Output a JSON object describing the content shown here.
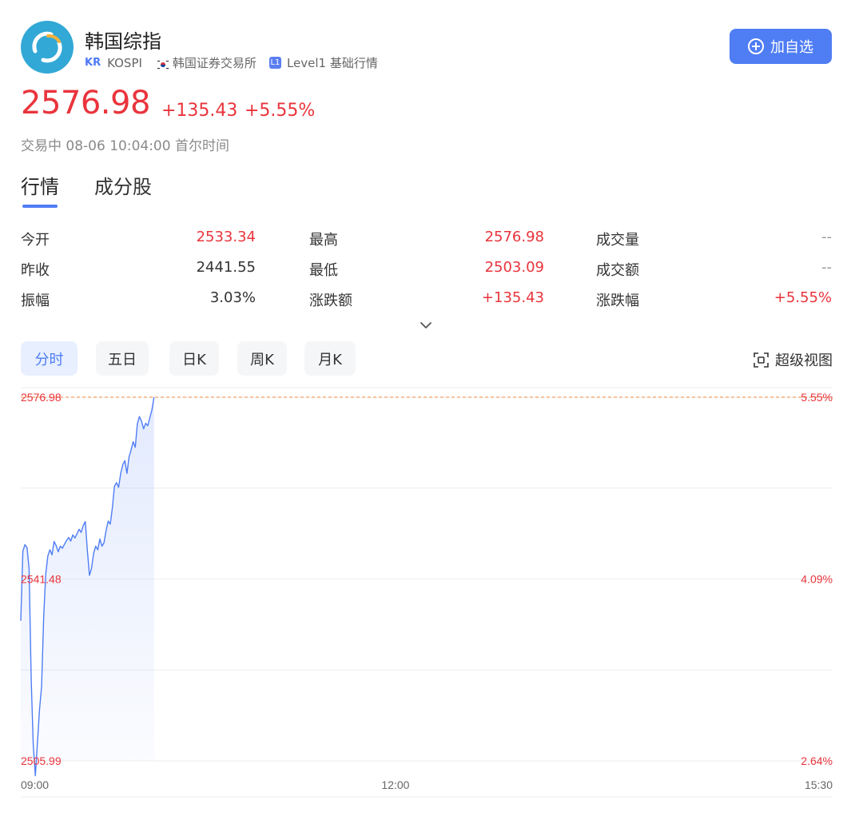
{
  "header": {
    "name": "韩国综指",
    "market_badge": "KR",
    "code": "KOSPI",
    "exchange": "韩国证券交易所",
    "level_badge": "L1",
    "level_text": "Level1 基础行情",
    "add_button_label": "加自选",
    "logo_icon": "kospi-logo-icon",
    "flag_icon": "south-korea-flag-icon"
  },
  "quote": {
    "price": "2576.98",
    "change": "+135.43",
    "change_pct": "+5.55%",
    "status": "交易中 08-06 10:04:00 首尔时间"
  },
  "tabs": [
    {
      "label": "行情",
      "active": true
    },
    {
      "label": "成分股",
      "active": false
    }
  ],
  "stats": [
    [
      {
        "label": "今开",
        "value": "2533.34",
        "color": "red"
      },
      {
        "label": "最高",
        "value": "2576.98",
        "color": "red"
      },
      {
        "label": "成交量",
        "value": "--",
        "color": "grey"
      }
    ],
    [
      {
        "label": "昨收",
        "value": "2441.55",
        "color": "dark"
      },
      {
        "label": "最低",
        "value": "2503.09",
        "color": "red"
      },
      {
        "label": "成交额",
        "value": "--",
        "color": "grey"
      }
    ],
    [
      {
        "label": "振幅",
        "value": "3.03%",
        "color": "dark"
      },
      {
        "label": "涨跌额",
        "value": "+135.43",
        "color": "red"
      },
      {
        "label": "涨跌幅",
        "value": "+5.55%",
        "color": "red"
      }
    ]
  ],
  "periods": [
    {
      "label": "分时",
      "active": true
    },
    {
      "label": "五日",
      "active": false
    },
    {
      "label": "日K",
      "active": false
    },
    {
      "label": "周K",
      "active": false
    },
    {
      "label": "月K",
      "active": false
    }
  ],
  "super_view_label": "超级视图",
  "colors": {
    "up": "#e9343c",
    "accent": "#4f7df4",
    "line": "#4f7df4",
    "ref_line": "#f08a3c"
  },
  "chart_data": {
    "type": "line",
    "x_start": "09:00",
    "x_mid": "12:00",
    "x_end": "15:30",
    "xlim": [
      "09:00",
      "15:30"
    ],
    "y_ticks": [
      "2576.98",
      "2541.48",
      "2505.99"
    ],
    "right_ticks": [
      "5.55%",
      "4.09%",
      "2.64%"
    ],
    "ylim": [
      2505.99,
      2576.98
    ],
    "ref_line_value": 2576.98,
    "x": [
      "09:00",
      "09:01",
      "09:02",
      "09:03",
      "09:04",
      "09:05",
      "09:06",
      "09:07",
      "09:08",
      "09:09",
      "09:10",
      "09:11",
      "09:12",
      "09:13",
      "09:14",
      "09:15",
      "09:16",
      "09:17",
      "09:18",
      "09:19",
      "09:20",
      "09:21",
      "09:22",
      "09:23",
      "09:24",
      "09:25",
      "09:26",
      "09:27",
      "09:28",
      "09:29",
      "09:30",
      "09:31",
      "09:32",
      "09:33",
      "09:34",
      "09:35",
      "09:36",
      "09:37",
      "09:38",
      "09:39",
      "09:40",
      "09:41",
      "09:42",
      "09:43",
      "09:44",
      "09:45",
      "09:46",
      "09:47",
      "09:48",
      "09:49",
      "09:50",
      "09:51",
      "09:52",
      "09:53",
      "09:54",
      "09:55",
      "09:56",
      "09:57",
      "09:58",
      "09:59",
      "10:00",
      "10:01",
      "10:02",
      "10:03",
      "10:04"
    ],
    "values": [
      2533.34,
      2546.9,
      2548.2,
      2547.6,
      2543.5,
      2522.0,
      2509.0,
      2503.09,
      2509.5,
      2516.0,
      2520.5,
      2534.0,
      2542.5,
      2546.0,
      2547.2,
      2546.2,
      2548.8,
      2548.0,
      2546.8,
      2547.9,
      2547.5,
      2548.3,
      2549.0,
      2549.6,
      2548.9,
      2550.1,
      2549.5,
      2550.3,
      2551.2,
      2550.6,
      2551.9,
      2552.7,
      2547.0,
      2542.2,
      2543.6,
      2546.5,
      2547.9,
      2547.2,
      2549.3,
      2547.9,
      2548.6,
      2551.0,
      2552.8,
      2552.2,
      2555.4,
      2559.6,
      2560.3,
      2559.4,
      2562.1,
      2563.8,
      2564.6,
      2562.1,
      2565.3,
      2566.7,
      2568.3,
      2567.2,
      2571.8,
      2573.2,
      2572.3,
      2570.8,
      2571.9,
      2571.4,
      2573.0,
      2574.5,
      2576.98
    ]
  }
}
